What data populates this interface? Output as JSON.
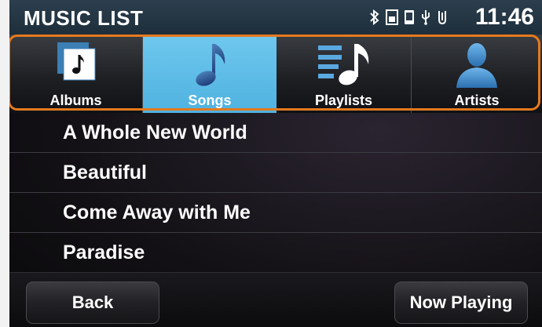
{
  "status": {
    "title": "MUSIC LIST",
    "time": "11:46",
    "icons": [
      "bluetooth-icon",
      "sim-icon",
      "phone-icon",
      "usb-icon",
      "signal-icon"
    ]
  },
  "tabs": [
    {
      "label": "Albums",
      "icon": "album-icon",
      "selected": false
    },
    {
      "label": "Songs",
      "icon": "music-note-icon",
      "selected": true
    },
    {
      "label": "Playlists",
      "icon": "playlist-icon",
      "selected": false
    },
    {
      "label": "Artists",
      "icon": "person-icon",
      "selected": false
    }
  ],
  "songs": [
    "A Whole New World",
    "Beautiful",
    "Come Away with Me",
    "Paradise"
  ],
  "buttons": {
    "back": "Back",
    "now_playing": "Now Playing"
  },
  "colors": {
    "active_tab": "#56b8e4",
    "highlight_border": "#e57a1e",
    "status_bar": "#24384a"
  }
}
